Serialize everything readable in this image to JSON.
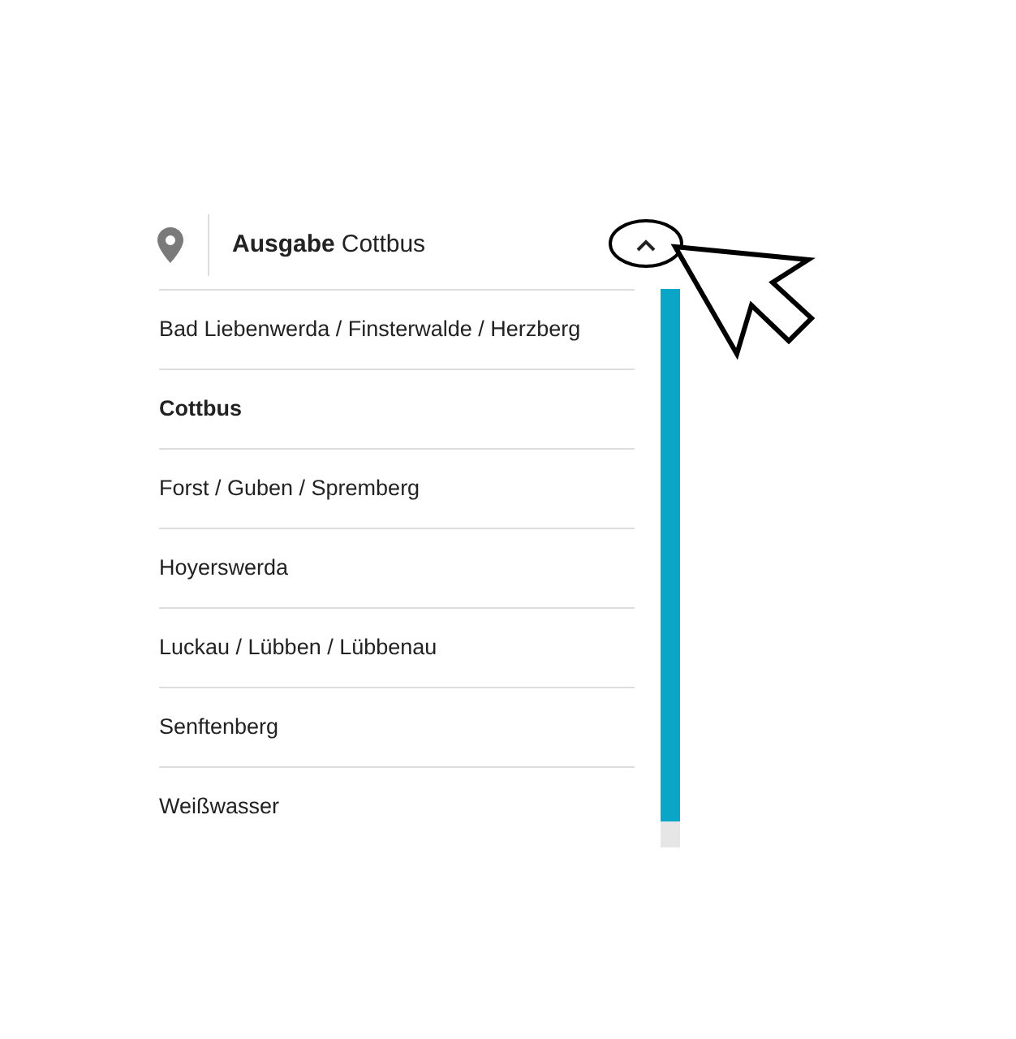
{
  "header": {
    "label": "Ausgabe",
    "value": "Cottbus",
    "expanded": true
  },
  "options": [
    {
      "label": "Bad Liebenwerda / Finsterwalde / Herzberg",
      "selected": false
    },
    {
      "label": "Cottbus",
      "selected": true
    },
    {
      "label": "Forst / Guben / Spremberg",
      "selected": false
    },
    {
      "label": "Hoyerswerda",
      "selected": false
    },
    {
      "label": "Luckau / Lübben / Lübbenau",
      "selected": false
    },
    {
      "label": "Senftenberg",
      "selected": false
    },
    {
      "label": "Weißwasser",
      "selected": false
    }
  ]
}
